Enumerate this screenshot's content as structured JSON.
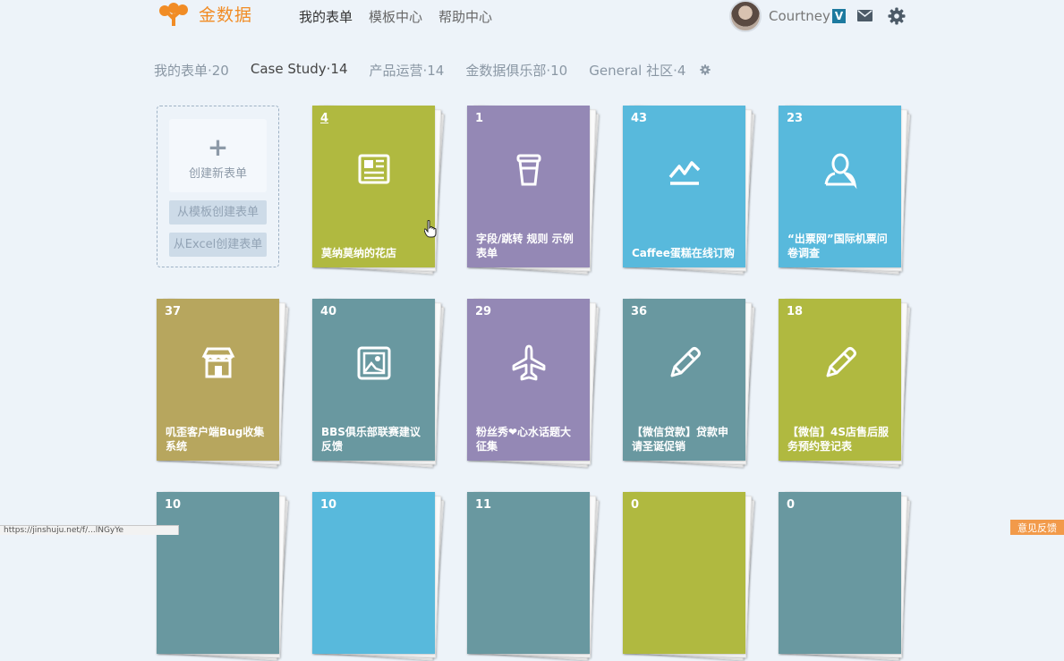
{
  "app": {
    "logo_text": "金数据"
  },
  "nav": [
    "我的表单",
    "模板中心",
    "帮助中心"
  ],
  "user": {
    "name": "Courtney",
    "badge": "V"
  },
  "tabs": [
    "我的表单·20",
    "Case Study·14",
    "产品运营·14",
    "金数据俱乐部·10",
    "General 社区·4"
  ],
  "create": {
    "main_label": "创建新表单",
    "from_template": "从模板创建表单",
    "from_excel": "从Excel创建表单"
  },
  "cards": [
    {
      "count": "4",
      "title": "莫纳莫纳的花店",
      "color": "#b0b940",
      "icon": "newspaper-icon"
    },
    {
      "count": "1",
      "title": "字段/跳转 规则 示例表单",
      "color": "#9488b5",
      "icon": "coffee-cup-icon"
    },
    {
      "count": "43",
      "title": "Caffee蛋糕在线订购",
      "color": "#58b9dc",
      "icon": "line-chart-icon"
    },
    {
      "count": "23",
      "title": "“出票网”国际机票问卷调查",
      "color": "#58b9dc",
      "icon": "user-icon"
    },
    {
      "count": "37",
      "title": "叽歪客户端Bug收集系统",
      "color": "#b7a65e",
      "icon": "store-icon"
    },
    {
      "count": "40",
      "title": "BBS俱乐部联赛建议反馈",
      "color": "#6998a0",
      "icon": "picture-icon"
    },
    {
      "count": "29",
      "title": "粉丝秀❤心水话题大征集",
      "color": "#9488b5",
      "icon": "airplane-icon"
    },
    {
      "count": "36",
      "title": "【微信贷款】贷款申请圣诞促销",
      "color": "#6998a0",
      "icon": "pencil-icon"
    },
    {
      "count": "18",
      "title": "【微信】4S店售后服务预约登记表",
      "color": "#b0b940",
      "icon": "pencil-icon"
    },
    {
      "count": "10",
      "title": "",
      "color": "#6998a0",
      "icon": ""
    },
    {
      "count": "10",
      "title": "",
      "color": "#58b9dc",
      "icon": ""
    },
    {
      "count": "11",
      "title": "",
      "color": "#6998a0",
      "icon": ""
    },
    {
      "count": "0",
      "title": "",
      "color": "#b0b940",
      "icon": ""
    },
    {
      "count": "0",
      "title": "",
      "color": "#6998a0",
      "icon": ""
    }
  ],
  "footer": {
    "status_url": "https://jinshuju.net/f/...lNGyYe",
    "feedback": "意见反馈"
  }
}
